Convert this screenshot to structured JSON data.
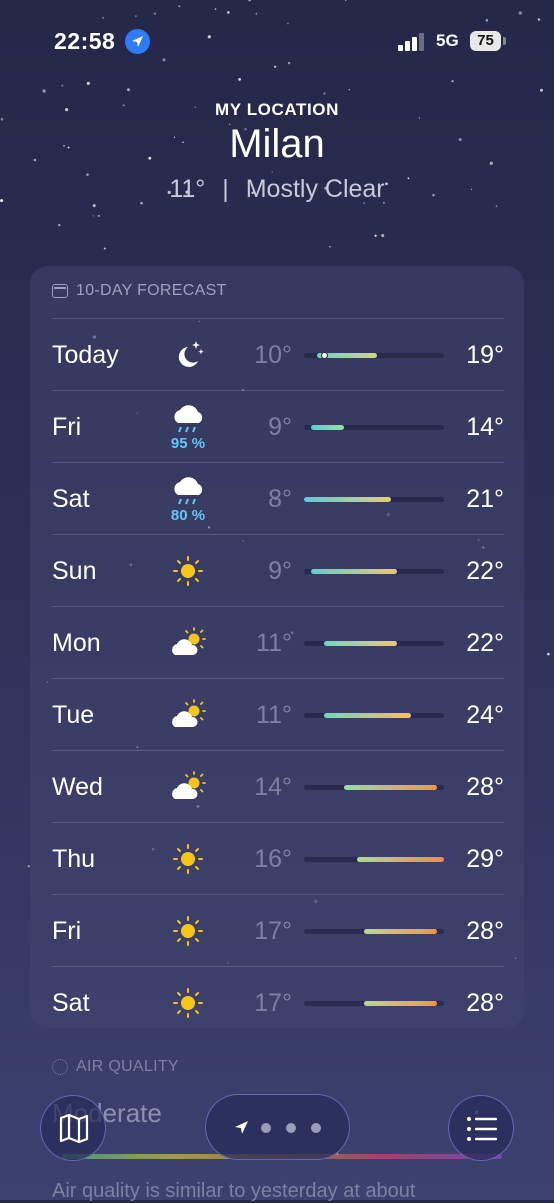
{
  "status_bar": {
    "time": "22:58",
    "network": "5G",
    "battery": "75"
  },
  "header": {
    "location_label": "MY LOCATION",
    "city": "Milan",
    "temp": "11°",
    "separator": "|",
    "condition": "Mostly Clear"
  },
  "forecast": {
    "title": "10-DAY FORECAST",
    "days": [
      {
        "day": "Today",
        "icon": "moon-stars-icon",
        "precip": "",
        "low": "10°",
        "high": "19°",
        "low_num": 10,
        "high_num": 19,
        "current": 11
      },
      {
        "day": "Fri",
        "icon": "cloud-rain-icon",
        "precip": "95 %",
        "low": "9°",
        "high": "14°",
        "low_num": 9,
        "high_num": 14
      },
      {
        "day": "Sat",
        "icon": "cloud-rain-icon",
        "precip": "80 %",
        "low": "8°",
        "high": "21°",
        "low_num": 8,
        "high_num": 21
      },
      {
        "day": "Sun",
        "icon": "sun-icon",
        "precip": "",
        "low": "9°",
        "high": "22°",
        "low_num": 9,
        "high_num": 22
      },
      {
        "day": "Mon",
        "icon": "partly-cloudy-icon",
        "precip": "",
        "low": "11°",
        "high": "22°",
        "low_num": 11,
        "high_num": 22
      },
      {
        "day": "Tue",
        "icon": "partly-cloudy-icon",
        "precip": "",
        "low": "11°",
        "high": "24°",
        "low_num": 11,
        "high_num": 24
      },
      {
        "day": "Wed",
        "icon": "partly-cloudy-icon",
        "precip": "",
        "low": "14°",
        "high": "28°",
        "low_num": 14,
        "high_num": 28
      },
      {
        "day": "Thu",
        "icon": "sun-icon",
        "precip": "",
        "low": "16°",
        "high": "29°",
        "low_num": 16,
        "high_num": 29
      },
      {
        "day": "Fri",
        "icon": "sun-icon",
        "precip": "",
        "low": "17°",
        "high": "28°",
        "low_num": 17,
        "high_num": 28
      },
      {
        "day": "Sat",
        "icon": "sun-icon",
        "precip": "",
        "low": "17°",
        "high": "28°",
        "low_num": 17,
        "high_num": 28
      }
    ]
  },
  "air_quality": {
    "title": "AIR QUALITY",
    "value": "Moderate",
    "description": "Air quality is similar to yesterday at about"
  },
  "bottom_bar": {
    "map_icon": "map-icon",
    "location_icon": "location-arrow-icon",
    "list_icon": "list-icon"
  },
  "colors": {
    "background": "#2b2d52",
    "rain": "#5ec8f6",
    "sun": "#f5c518"
  }
}
